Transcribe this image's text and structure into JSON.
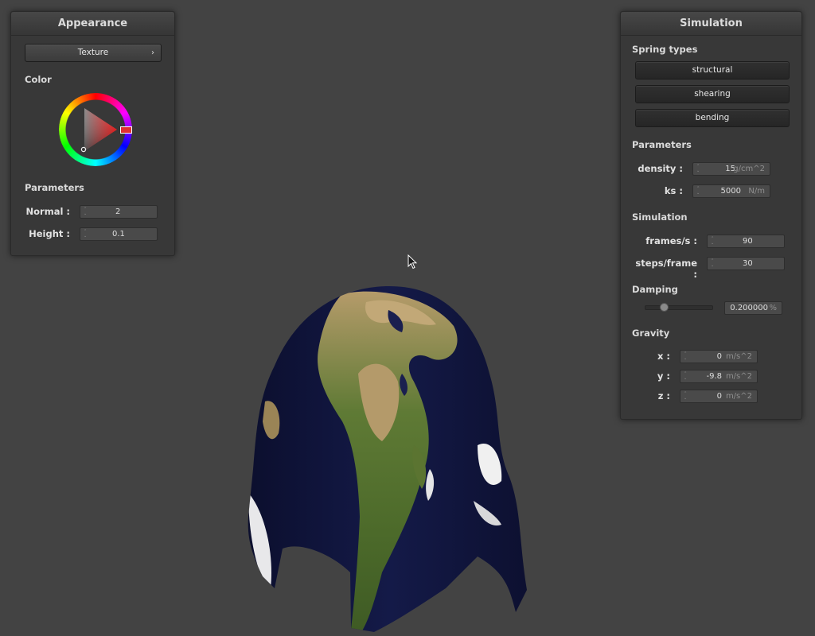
{
  "appearance": {
    "title": "Appearance",
    "texture_button": "Texture",
    "color_section": "Color",
    "params_section": "Parameters",
    "normal_label": "Normal :",
    "normal_value": "2",
    "height_label": "Height :",
    "height_value": "0.1",
    "selected_color": "#ff0000"
  },
  "simulation": {
    "title": "Simulation",
    "spring_section": "Spring types",
    "spring_buttons": [
      "structural",
      "shearing",
      "bending"
    ],
    "params_section": "Parameters",
    "density_label": "density :",
    "density_value": "15",
    "density_unit": "g/cm^2",
    "ks_label": "ks :",
    "ks_value": "5000",
    "ks_unit": "N/m",
    "sim_section": "Simulation",
    "fps_label": "frames/s :",
    "fps_value": "90",
    "steps_label": "steps/frame :",
    "steps_value": "30",
    "damping_section": "Damping",
    "damping_value": "0.200000",
    "damping_unit": "%",
    "damping_fraction": 0.2,
    "gravity_section": "Gravity",
    "gx_label": "x :",
    "gx_value": "0",
    "gy_label": "y :",
    "gy_value": "-9.8",
    "gz_label": "z :",
    "gz_value": "0",
    "gravity_unit": "m/s^2"
  },
  "icons": {
    "chevron": "chevron-right-icon",
    "cursor": "mouse-cursor-icon"
  },
  "colors": {
    "background": "#434343",
    "panel": "#383838",
    "ocean": "#0f1236",
    "land": "#4e6d2c"
  }
}
